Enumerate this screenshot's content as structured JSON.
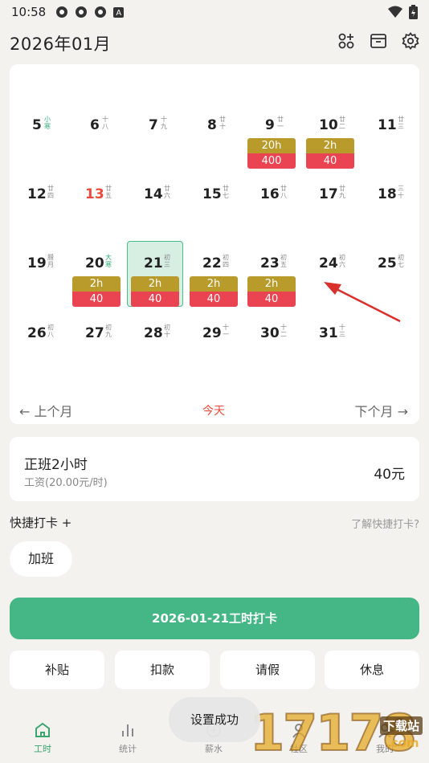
{
  "status": {
    "time": "10:58",
    "badge_letter": "A"
  },
  "header": {
    "title": "2026年01月",
    "icons": [
      "apps-add-icon",
      "archive-box-icon",
      "settings-gear-icon"
    ]
  },
  "calendar": {
    "rows": [
      [
        {
          "n": "5",
          "l": "小寒",
          "term": true
        },
        {
          "n": "6",
          "l": "十八"
        },
        {
          "n": "7",
          "l": "十九"
        },
        {
          "n": "8",
          "l": "廿十"
        },
        {
          "n": "9",
          "l": "廿一",
          "h": "20h",
          "p": "400"
        },
        {
          "n": "10",
          "l": "廿二",
          "h": "2h",
          "p": "40"
        },
        {
          "n": "11",
          "l": "廿三"
        }
      ],
      [
        {
          "n": "12",
          "l": "廿四"
        },
        {
          "n": "13",
          "l": "廿五",
          "red": true
        },
        {
          "n": "14",
          "l": "廿六"
        },
        {
          "n": "15",
          "l": "廿七"
        },
        {
          "n": "16",
          "l": "廿八"
        },
        {
          "n": "17",
          "l": "廿九"
        },
        {
          "n": "18",
          "l": "三十"
        }
      ],
      [
        {
          "n": "19",
          "l": "腊月"
        },
        {
          "n": "20",
          "l": "大寒",
          "term": true,
          "h": "2h",
          "p": "40"
        },
        {
          "n": "21",
          "l": "初三",
          "h": "2h",
          "p": "40",
          "selected": true
        },
        {
          "n": "22",
          "l": "初四",
          "h": "2h",
          "p": "40"
        },
        {
          "n": "23",
          "l": "初五",
          "h": "2h",
          "p": "40"
        },
        {
          "n": "24",
          "l": "初六"
        },
        {
          "n": "25",
          "l": "初七"
        }
      ],
      [
        {
          "n": "26",
          "l": "初八"
        },
        {
          "n": "27",
          "l": "初九"
        },
        {
          "n": "28",
          "l": "初十"
        },
        {
          "n": "29",
          "l": "十一"
        },
        {
          "n": "30",
          "l": "十二"
        },
        {
          "n": "31",
          "l": "十三"
        }
      ]
    ]
  },
  "month_nav": {
    "prev": "← 上个月",
    "today": "今天",
    "next": "下个月 →"
  },
  "summary": {
    "title": "正班2小时",
    "subtitle": "工资(20.00元/时)",
    "amount": "40元"
  },
  "quick": {
    "label": "快捷打卡 +",
    "help": "了解快捷打卡?",
    "chip": "加班"
  },
  "punch_button": "2026-01-21工时打卡",
  "actions": [
    "补贴",
    "扣款",
    "请假",
    "休息"
  ],
  "nav": [
    {
      "label": "工时",
      "icon": "home-icon",
      "active": true
    },
    {
      "label": "统计",
      "icon": "bar-chart-icon"
    },
    {
      "label": "薪水",
      "icon": "wallet-icon"
    },
    {
      "label": "社区",
      "icon": "community-icon"
    },
    {
      "label": "我的",
      "icon": "profile-icon"
    }
  ],
  "toast": "设置成功",
  "watermark": {
    "main": "17178",
    "sub": "下载站",
    "domain": ".com"
  },
  "colors": {
    "accent": "#45b685",
    "hours_badge": "#b89b2a",
    "pay_badge": "#ea4351",
    "weekend_red": "#e94b3c"
  }
}
